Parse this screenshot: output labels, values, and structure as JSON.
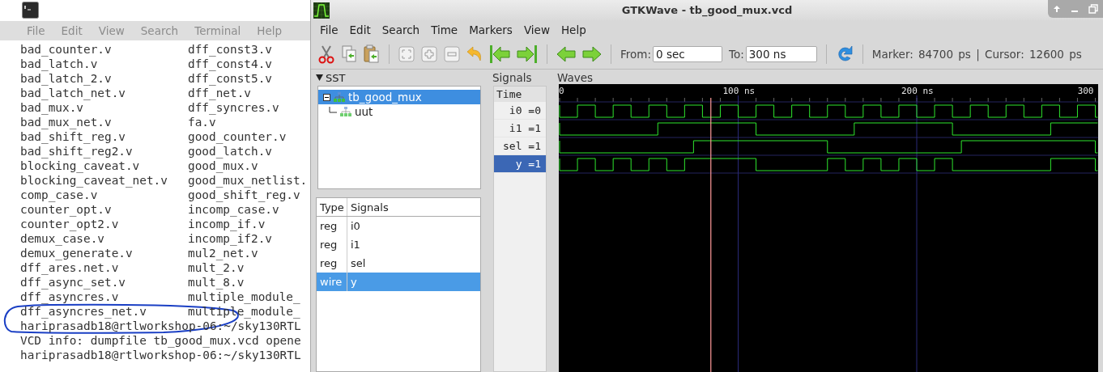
{
  "terminal": {
    "menu": [
      "File",
      "Edit",
      "View",
      "Search",
      "Terminal",
      "Help"
    ],
    "listing": [
      {
        "left": "bad_counter.v",
        "right": "dff_const3.v"
      },
      {
        "left": "bad_latch.v",
        "right": "dff_const4.v"
      },
      {
        "left": "bad_latch_2.v",
        "right": "dff_const5.v"
      },
      {
        "left": "bad_latch_net.v",
        "right": "dff_net.v"
      },
      {
        "left": "bad_mux.v",
        "right": "dff_syncres.v"
      },
      {
        "left": "bad_mux_net.v",
        "right": "fa.v"
      },
      {
        "left": "bad_shift_reg.v",
        "right": "good_counter.v"
      },
      {
        "left": "bad_shift_reg2.v",
        "right": "good_latch.v"
      },
      {
        "left": "blocking_caveat.v",
        "right": "good_mux.v"
      },
      {
        "left": "blocking_caveat_net.v",
        "right": "good_mux_netlist."
      },
      {
        "left": "comp_case.v",
        "right": "good_shift_reg.v"
      },
      {
        "left": "counter_opt.v",
        "right": "incomp_case.v"
      },
      {
        "left": "counter_opt2.v",
        "right": "incomp_if.v"
      },
      {
        "left": "demux_case.v",
        "right": "incomp_if2.v"
      },
      {
        "left": "demux_generate.v",
        "right": "mul2_net.v"
      },
      {
        "left": "dff_ares.net.v",
        "right": "mult_2.v"
      },
      {
        "left": "dff_async_set.v",
        "right": "mult_8.v"
      },
      {
        "left": "dff_asyncres.v",
        "right": "multiple_module_"
      },
      {
        "left": "dff_asyncres_net.v",
        "right": "multiple_module_"
      }
    ],
    "lines": [
      "hariprasadb18@rtlworkshop-06:~/sky130RTL",
      "VCD info: dumpfile tb_good_mux.vcd opene",
      "hariprasadb18@rtlworkshop-06:~/sky130RTL"
    ]
  },
  "gtkwave": {
    "title": "GTKWave - tb_good_mux.vcd",
    "menu": [
      "File",
      "Edit",
      "Search",
      "Time",
      "Markers",
      "View",
      "Help"
    ],
    "from": {
      "label": "From:",
      "value": "0 sec"
    },
    "to": {
      "label": "To:",
      "value": "300 ns"
    },
    "status": "Marker: 84700 ps | Cursor: 12600 ps",
    "sst": {
      "title": "SST",
      "tree": [
        {
          "label": "tb_good_mux",
          "expanded": true,
          "selected": true,
          "children": [
            {
              "label": "uut",
              "selected": false
            }
          ]
        }
      ],
      "columns": [
        "Type",
        "Signals"
      ],
      "rows": [
        {
          "type": "reg",
          "signal": "i0",
          "selected": false
        },
        {
          "type": "reg",
          "signal": "i1",
          "selected": false
        },
        {
          "type": "reg",
          "signal": "sel",
          "selected": false
        },
        {
          "type": "wire",
          "signal": "y",
          "selected": true
        }
      ]
    },
    "signals": {
      "title": "Signals",
      "header": "Time",
      "items": [
        {
          "label": "i0 =0",
          "selected": false
        },
        {
          "label": "i1 =1",
          "selected": false
        },
        {
          "label": "sel =1",
          "selected": false
        },
        {
          "label": "y =1",
          "selected": true
        }
      ]
    },
    "waves": {
      "title": "Waves",
      "ticks": [
        "0",
        "100 ns",
        "200 ns",
        "300"
      ]
    }
  }
}
